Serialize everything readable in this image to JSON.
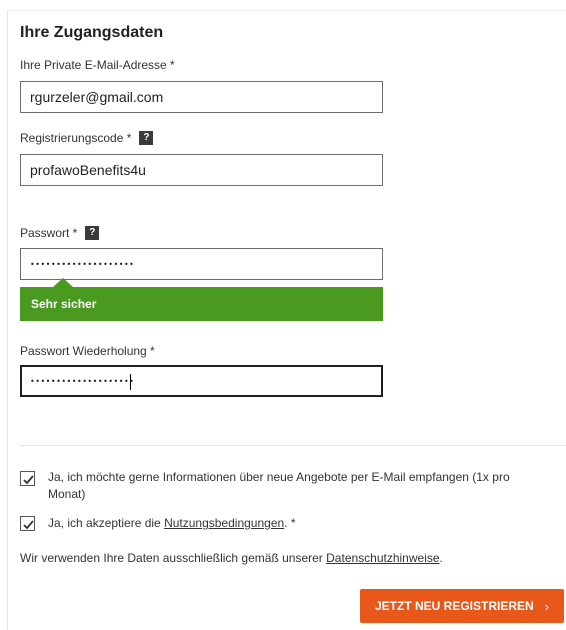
{
  "section": {
    "title": "Ihre Zugangsdaten"
  },
  "email": {
    "label": "Ihre Private E-Mail-Adresse *",
    "value": "rgurzeler@gmail.com"
  },
  "regcode": {
    "label": "Registrierungscode *",
    "help": "?",
    "value": "profawoBenefits4u"
  },
  "password": {
    "label": "Passwort *",
    "help": "?",
    "masked": "••••••••••••••••••••",
    "strength": "Sehr sicher",
    "strength_color": "#4a9a1f"
  },
  "password_repeat": {
    "label": "Passwort Wiederholung *",
    "masked": "••••••••••••••••••••"
  },
  "newsletter": {
    "checked": true,
    "text": "Ja, ich möchte gerne Informationen über neue Angebote per E-Mail empfangen (1x pro Monat)"
  },
  "terms": {
    "checked": true,
    "prefix": "Ja, ich akzeptiere die ",
    "link": "Nutzungsbedingungen",
    "suffix": ". *"
  },
  "privacy": {
    "prefix": "Wir verwenden Ihre Daten ausschließlich gemäß unserer ",
    "link": "Datenschutzhinweise",
    "suffix": "."
  },
  "submit": {
    "label": "JETZT NEU REGISTRIEREN",
    "icon": "chevron-right-icon",
    "glyph": "›",
    "color": "#e8581a"
  }
}
